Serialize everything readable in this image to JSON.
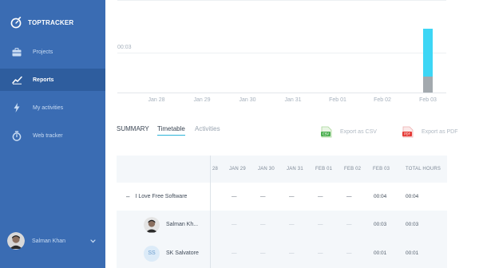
{
  "app": {
    "name": "TOPTRACKER"
  },
  "nav": [
    {
      "label": "Projects",
      "icon": "briefcase-icon",
      "active": false
    },
    {
      "label": "Reports",
      "icon": "chart-line-icon",
      "active": true
    },
    {
      "label": "My activities",
      "icon": "lightning-icon",
      "active": false
    },
    {
      "label": "Web tracker",
      "icon": "stopwatch-icon",
      "active": false
    }
  ],
  "user": {
    "name": "Salman Khan"
  },
  "colors": {
    "sidebar": "#3a6cb3",
    "sidebar_active": "#2e5d9e",
    "bar_primary": "#3dd6f5",
    "bar_secondary": "#a3a9ae",
    "accent": "#2db4d8"
  },
  "chart_data": {
    "type": "bar",
    "stacked": true,
    "categories": [
      "Jan 28",
      "Jan 29",
      "Jan 30",
      "Jan 31",
      "Feb 01",
      "Feb 02",
      "Feb 03"
    ],
    "yticks_visible": [
      "00:03"
    ],
    "series": [
      {
        "values_minutes": [
          0,
          0,
          0,
          0,
          0,
          0,
          1
        ],
        "color": "#a3a9ae"
      },
      {
        "values_minutes": [
          0,
          0,
          0,
          0,
          0,
          0,
          3
        ],
        "color": "#3dd6f5"
      }
    ],
    "ylim_minutes": [
      0,
      4
    ]
  },
  "tabs": [
    "SUMMARY",
    "Timetable",
    "Activities"
  ],
  "active_tab": "Timetable",
  "export": {
    "csv_label": "Export as CSV",
    "pdf_label": "Export as PDF"
  },
  "table": {
    "columns": [
      "28",
      "JAN 29",
      "JAN 30",
      "JAN 31",
      "FEB 01",
      "FEB 02",
      "FEB 03",
      "TOTAL HOURS"
    ],
    "project": {
      "name": "I Love Free Software",
      "collapse_symbol": "–",
      "cells": [
        "—",
        "—",
        "—",
        "—",
        "—",
        "—",
        "00:04",
        "00:04"
      ]
    },
    "members": [
      {
        "name": "Salman Kh...",
        "avatar": "photo",
        "cells": [
          "—",
          "—",
          "—",
          "—",
          "—",
          "—",
          "00:03",
          "00:03"
        ]
      },
      {
        "name": "SK Salvatore",
        "initials": "SS",
        "cells": [
          "—",
          "—",
          "—",
          "—",
          "—",
          "—",
          "00:01",
          "00:01"
        ]
      }
    ]
  }
}
